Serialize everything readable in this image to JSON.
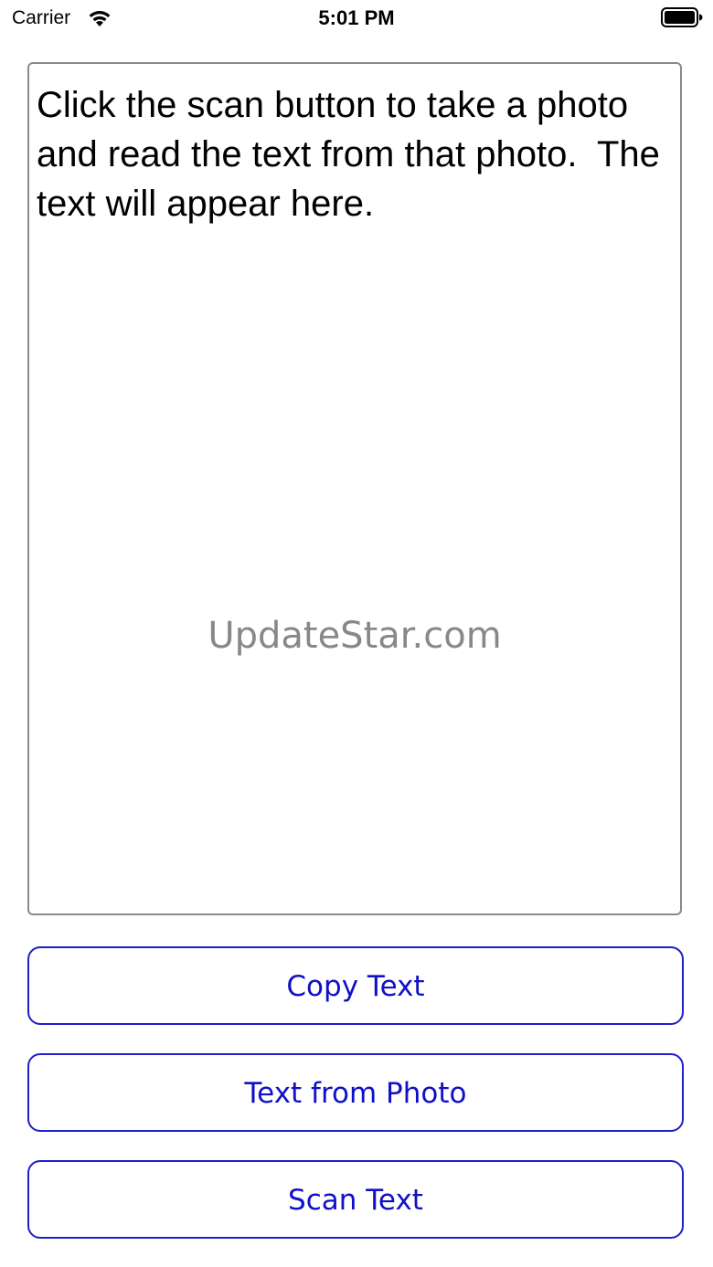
{
  "status_bar": {
    "carrier": "Carrier",
    "time": "5:01 PM",
    "wifi_icon": "wifi-icon",
    "battery_icon": "battery-icon"
  },
  "text_view": {
    "content": "Click the scan button to take a photo and read the text from that photo.  The text will appear here.",
    "border_color": "#8a8a8a"
  },
  "watermark": {
    "text": "UpdateStar.com"
  },
  "buttons": {
    "copy_label": "Copy Text",
    "photo_label": "Text from Photo",
    "scan_label": "Scan Text",
    "accent_color": "#1010c8"
  }
}
